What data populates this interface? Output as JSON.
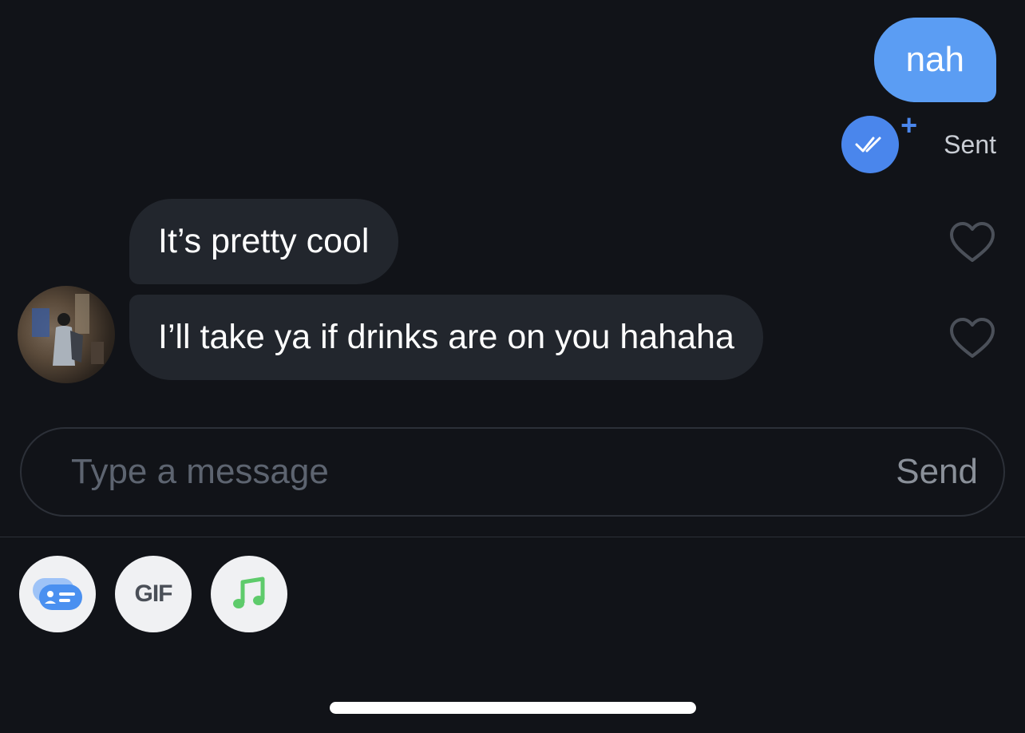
{
  "messages": {
    "outgoing": [
      {
        "text": "nah",
        "status": "Sent"
      }
    ],
    "incoming": [
      {
        "text": "It’s pretty cool"
      },
      {
        "text": "I’ll take ya if drinks are on you hahaha"
      }
    ]
  },
  "composer": {
    "placeholder": "Type a message",
    "send_label": "Send"
  },
  "toolbar": {
    "items": [
      {
        "icon": "profile-card-icon"
      },
      {
        "label": "GIF"
      },
      {
        "icon": "music-note-icon"
      }
    ]
  },
  "colors": {
    "background": "#111318",
    "outgoing_bubble": "#5b9df3",
    "incoming_bubble": "#22262d",
    "accent": "#4a86ec",
    "music_green": "#5ecb6b"
  }
}
